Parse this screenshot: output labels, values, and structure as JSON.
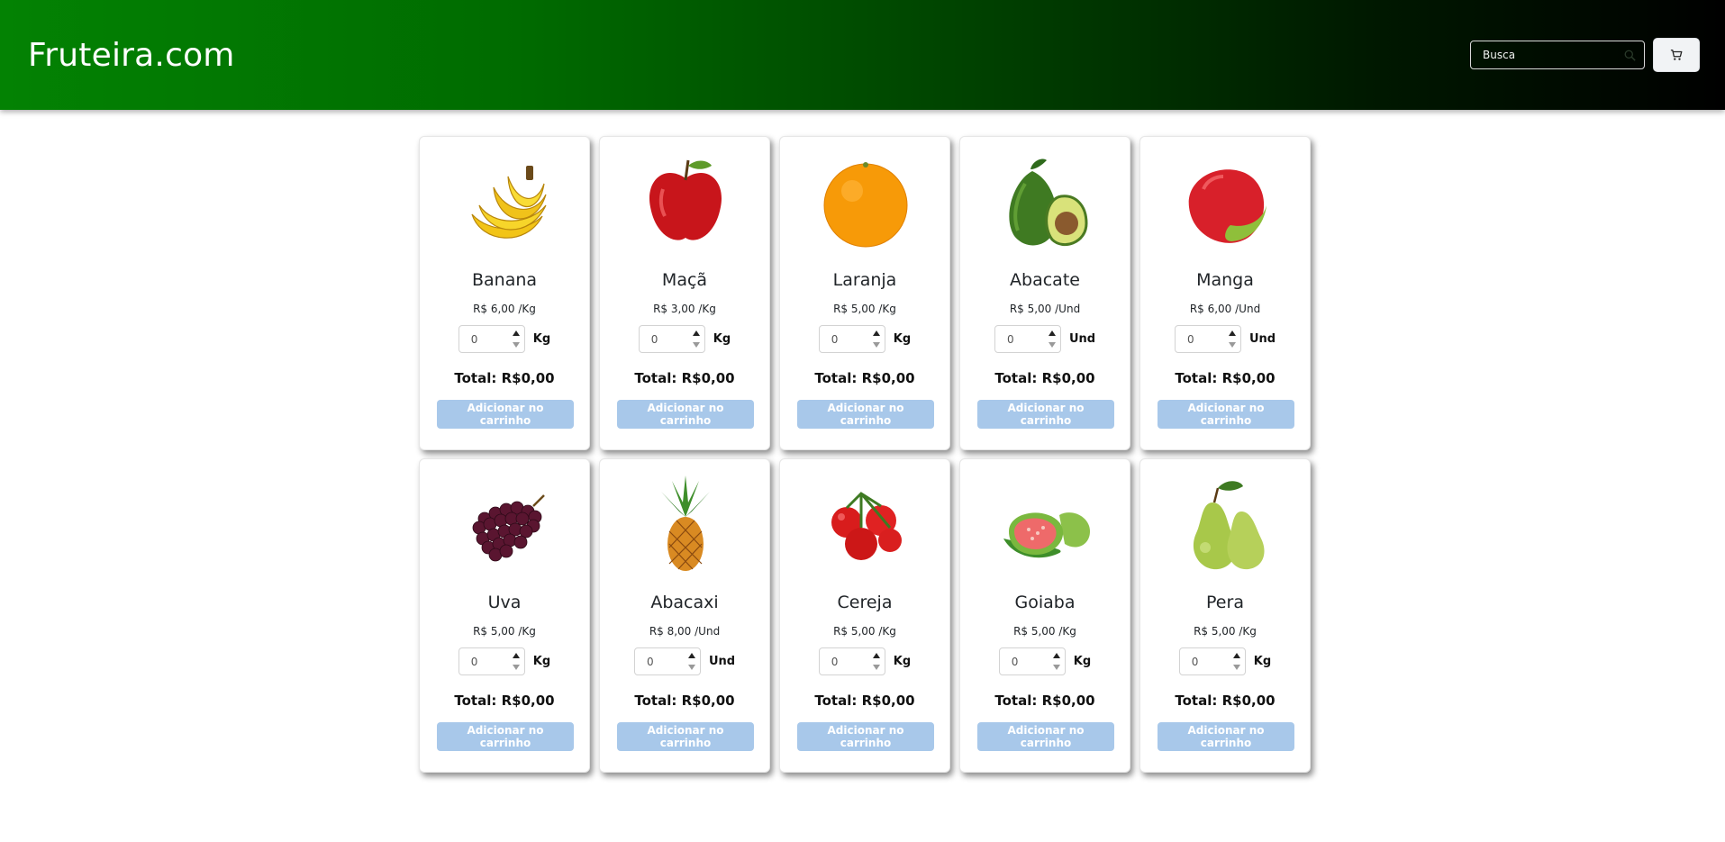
{
  "header": {
    "brand": "Fruteira.com",
    "search_placeholder": "Busca",
    "search_icon": "search-icon",
    "cart_icon": "cart-icon",
    "gradient_colors": [
      "#038203",
      "#000000"
    ]
  },
  "add_button_label": "Adicionar no carrinho",
  "add_button_color": "#a8c8ea",
  "products": [
    {
      "name": "Banana",
      "price": "R$ 6,00 /Kg",
      "qty": "0",
      "unit": "Kg",
      "total": "Total: R$0,00",
      "image": "banana"
    },
    {
      "name": "Maçã",
      "price": "R$ 3,00 /Kg",
      "qty": "0",
      "unit": "Kg",
      "total": "Total: R$0,00",
      "image": "apple"
    },
    {
      "name": "Laranja",
      "price": "R$ 5,00 /Kg",
      "qty": "0",
      "unit": "Kg",
      "total": "Total: R$0,00",
      "image": "orange"
    },
    {
      "name": "Abacate",
      "price": "R$ 5,00 /Und",
      "qty": "0",
      "unit": "Und",
      "total": "Total: R$0,00",
      "image": "avocado"
    },
    {
      "name": "Manga",
      "price": "R$ 6,00 /Und",
      "qty": "0",
      "unit": "Und",
      "total": "Total: R$0,00",
      "image": "mango"
    },
    {
      "name": "Uva",
      "price": "R$ 5,00 /Kg",
      "qty": "0",
      "unit": "Kg",
      "total": "Total: R$0,00",
      "image": "grapes"
    },
    {
      "name": "Abacaxi",
      "price": "R$ 8,00 /Und",
      "qty": "0",
      "unit": "Und",
      "total": "Total: R$0,00",
      "image": "pineapple"
    },
    {
      "name": "Cereja",
      "price": "R$ 5,00 /Kg",
      "qty": "0",
      "unit": "Kg",
      "total": "Total: R$0,00",
      "image": "tomatoes"
    },
    {
      "name": "Goiaba",
      "price": "R$ 5,00 /Kg",
      "qty": "0",
      "unit": "Kg",
      "total": "Total: R$0,00",
      "image": "guava"
    },
    {
      "name": "Pera",
      "price": "R$ 5,00 /Kg",
      "qty": "0",
      "unit": "Kg",
      "total": "Total: R$0,00",
      "image": "pear"
    }
  ]
}
